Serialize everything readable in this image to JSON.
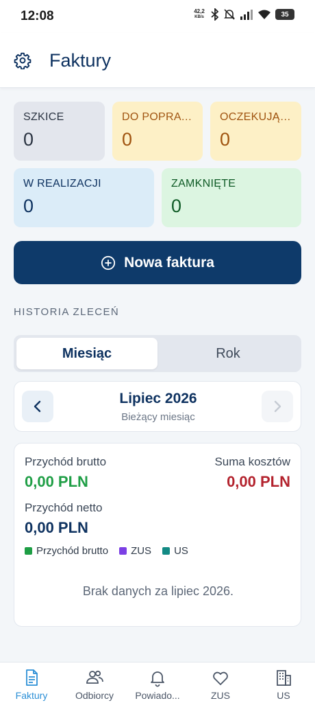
{
  "status_bar": {
    "time": "12:08",
    "speed": "42,2",
    "speed_unit": "KB/s",
    "battery": "35"
  },
  "header": {
    "title": "Faktury"
  },
  "cards": [
    {
      "label": "SZKICE",
      "count": "0"
    },
    {
      "label": "DO POPRAWY",
      "count": "0"
    },
    {
      "label": "OCZEKUJĄCE",
      "count": "0"
    },
    {
      "label": "W REALIZACJI",
      "count": "0"
    },
    {
      "label": "ZAMKNIĘTE",
      "count": "0"
    }
  ],
  "new_invoice_button": "Nowa faktura",
  "history_title": "HISTORIA ZLECEŃ",
  "segments": {
    "month": "Miesiąc",
    "year": "Rok"
  },
  "period": {
    "title": "Lipiec 2026",
    "subtitle": "Bieżący miesiąc"
  },
  "summary": {
    "gross_label": "Przychód brutto",
    "gross_value": "0,00 PLN",
    "costs_label": "Suma kosztów",
    "costs_value": "0,00 PLN",
    "net_label": "Przychód netto",
    "net_value": "0,00 PLN",
    "legend": [
      {
        "label": "Przychód brutto",
        "color": "#1e9e45"
      },
      {
        "label": "ZUS",
        "color": "#7b3fe4"
      },
      {
        "label": "US",
        "color": "#138a84"
      }
    ],
    "empty_text": "Brak danych za lipiec 2026."
  },
  "colors": {
    "primary": "#0e3a6a",
    "gross": "#1e9e45",
    "costs": "#b3222d",
    "active_tab": "#2b8fd6"
  },
  "bottom_nav": [
    {
      "label": "Faktury",
      "icon": "document-icon"
    },
    {
      "label": "Odbiorcy",
      "icon": "users-icon"
    },
    {
      "label": "Powiado...",
      "icon": "bell-icon"
    },
    {
      "label": "ZUS",
      "icon": "heart-icon"
    },
    {
      "label": "US",
      "icon": "building-icon"
    }
  ]
}
